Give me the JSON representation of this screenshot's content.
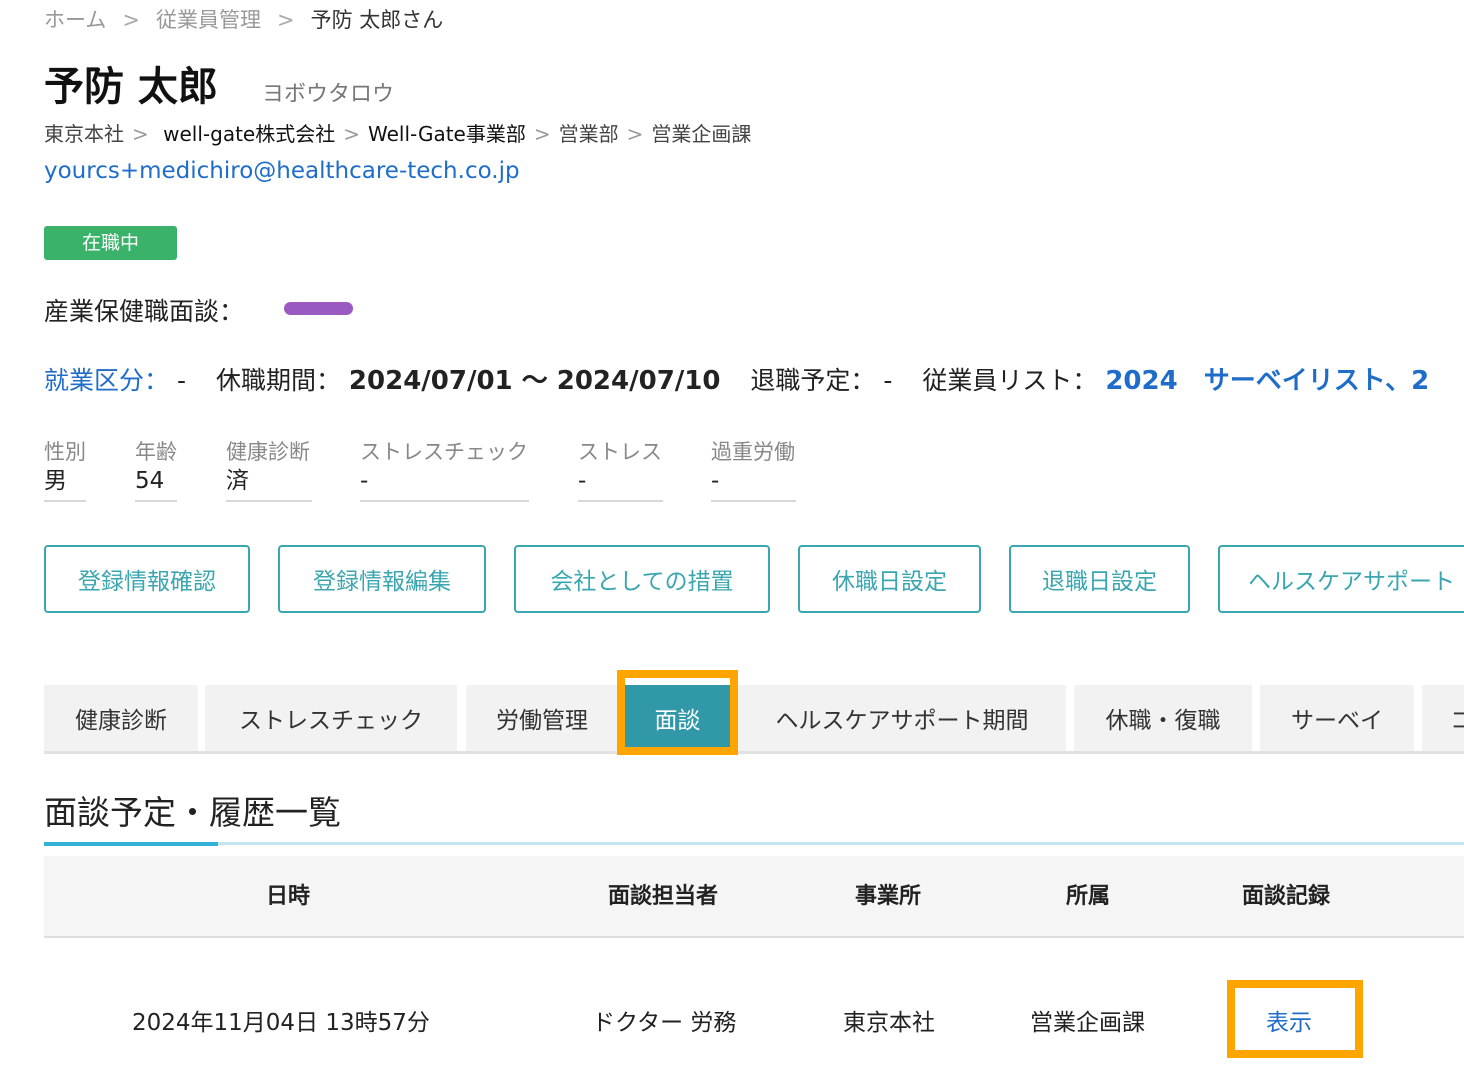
{
  "breadcrumb": {
    "home": "ホーム",
    "employees": "従業員管理",
    "current": "予防 太郎さん",
    "separator": ">"
  },
  "employee": {
    "name": "予防 太郎",
    "kana": "ヨボウタロウ",
    "org_path": [
      "東京本社",
      "well-gate株式会社",
      "Well-Gate事業部",
      "営業部",
      "営業企画課"
    ],
    "org_separator": ">",
    "email": "yourcs+medichiro@healthcare-tech.co.jp",
    "status": "在職中",
    "interview_label": "産業保健職面談：",
    "interview_color": "#9b59c2"
  },
  "info": {
    "work_category_label": "就業区分：",
    "work_category_value": "-",
    "leave_period_label": "休職期間：",
    "leave_period_value": "2024/07/01 ～ 2024/07/10",
    "retire_label": "退職予定：",
    "retire_value": "-",
    "list_label": "従業員リスト：",
    "list_value": "2024　サーベイリスト、2"
  },
  "attributes": [
    {
      "key": "性別",
      "value": "男"
    },
    {
      "key": "年齢",
      "value": "54"
    },
    {
      "key": "健康診断",
      "value": "済"
    },
    {
      "key": "ストレスチェック",
      "value": "-"
    },
    {
      "key": "ストレス",
      "value": "-"
    },
    {
      "key": "過重労働",
      "value": "-"
    }
  ],
  "actions": [
    "登録情報確認",
    "登録情報編集",
    "会社としての措置",
    "休職日設定",
    "退職日設定",
    "ヘルスケアサポート"
  ],
  "tabs": [
    "健康診断",
    "ストレスチェック",
    "労働管理",
    "面談",
    "ヘルスケアサポート期間",
    "休職・復職",
    "サーベイ",
    "コ"
  ],
  "active_tab": "面談",
  "section": {
    "title": "面談予定・履歴一覧",
    "columns": [
      "日時",
      "面談担当者",
      "事業所",
      "所属",
      "面談記録"
    ],
    "rows": [
      {
        "datetime": "2024年11月04日 13時57分",
        "staff": "ドクター 労務",
        "office": "東京本社",
        "dept": "営業企画課",
        "record": "表示"
      }
    ]
  },
  "colors": {
    "accent": "#3098a6",
    "link": "#1f6dc9",
    "status": "#3bb26a",
    "highlight": "#ffa500"
  }
}
